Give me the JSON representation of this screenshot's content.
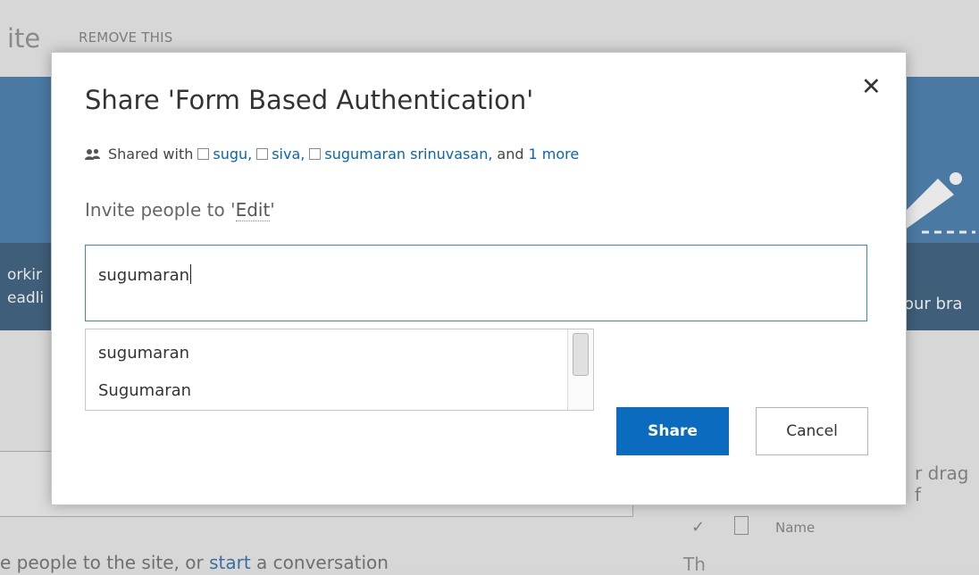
{
  "background": {
    "site_title": "ite",
    "remove_link": "REMOVE THIS",
    "banner_left_text_1": "orkir",
    "banner_left_text_2": "eadli",
    "banner_right_text": "our bra",
    "drag_text": "r drag f",
    "checkmark": "✓",
    "name_column": "Name",
    "bottom_text_prefix": "e people to the site, or ",
    "bottom_link": "start",
    "bottom_text_suffix": " a conversation",
    "right_bottom_text": "Th"
  },
  "dialog": {
    "title": "Share 'Form Based Authentication'",
    "close_glyph": "✕",
    "shared_with_label": "Shared with",
    "shared_people": [
      "sugu,",
      "siva,",
      "sugumaran srinuvasan,"
    ],
    "and_text": "and",
    "more_link": "1 more",
    "invite_prefix": "Invite people to '",
    "invite_permission": "Edit",
    "invite_suffix": "'",
    "input_value": "sugumaran",
    "suggestions": [
      "sugumaran",
      "Sugumaran"
    ],
    "share_button": "Share",
    "cancel_button": "Cancel"
  },
  "colors": {
    "accent": "#0b6cbf",
    "link": "#0b64b7",
    "input_border": "#3f86c4"
  }
}
